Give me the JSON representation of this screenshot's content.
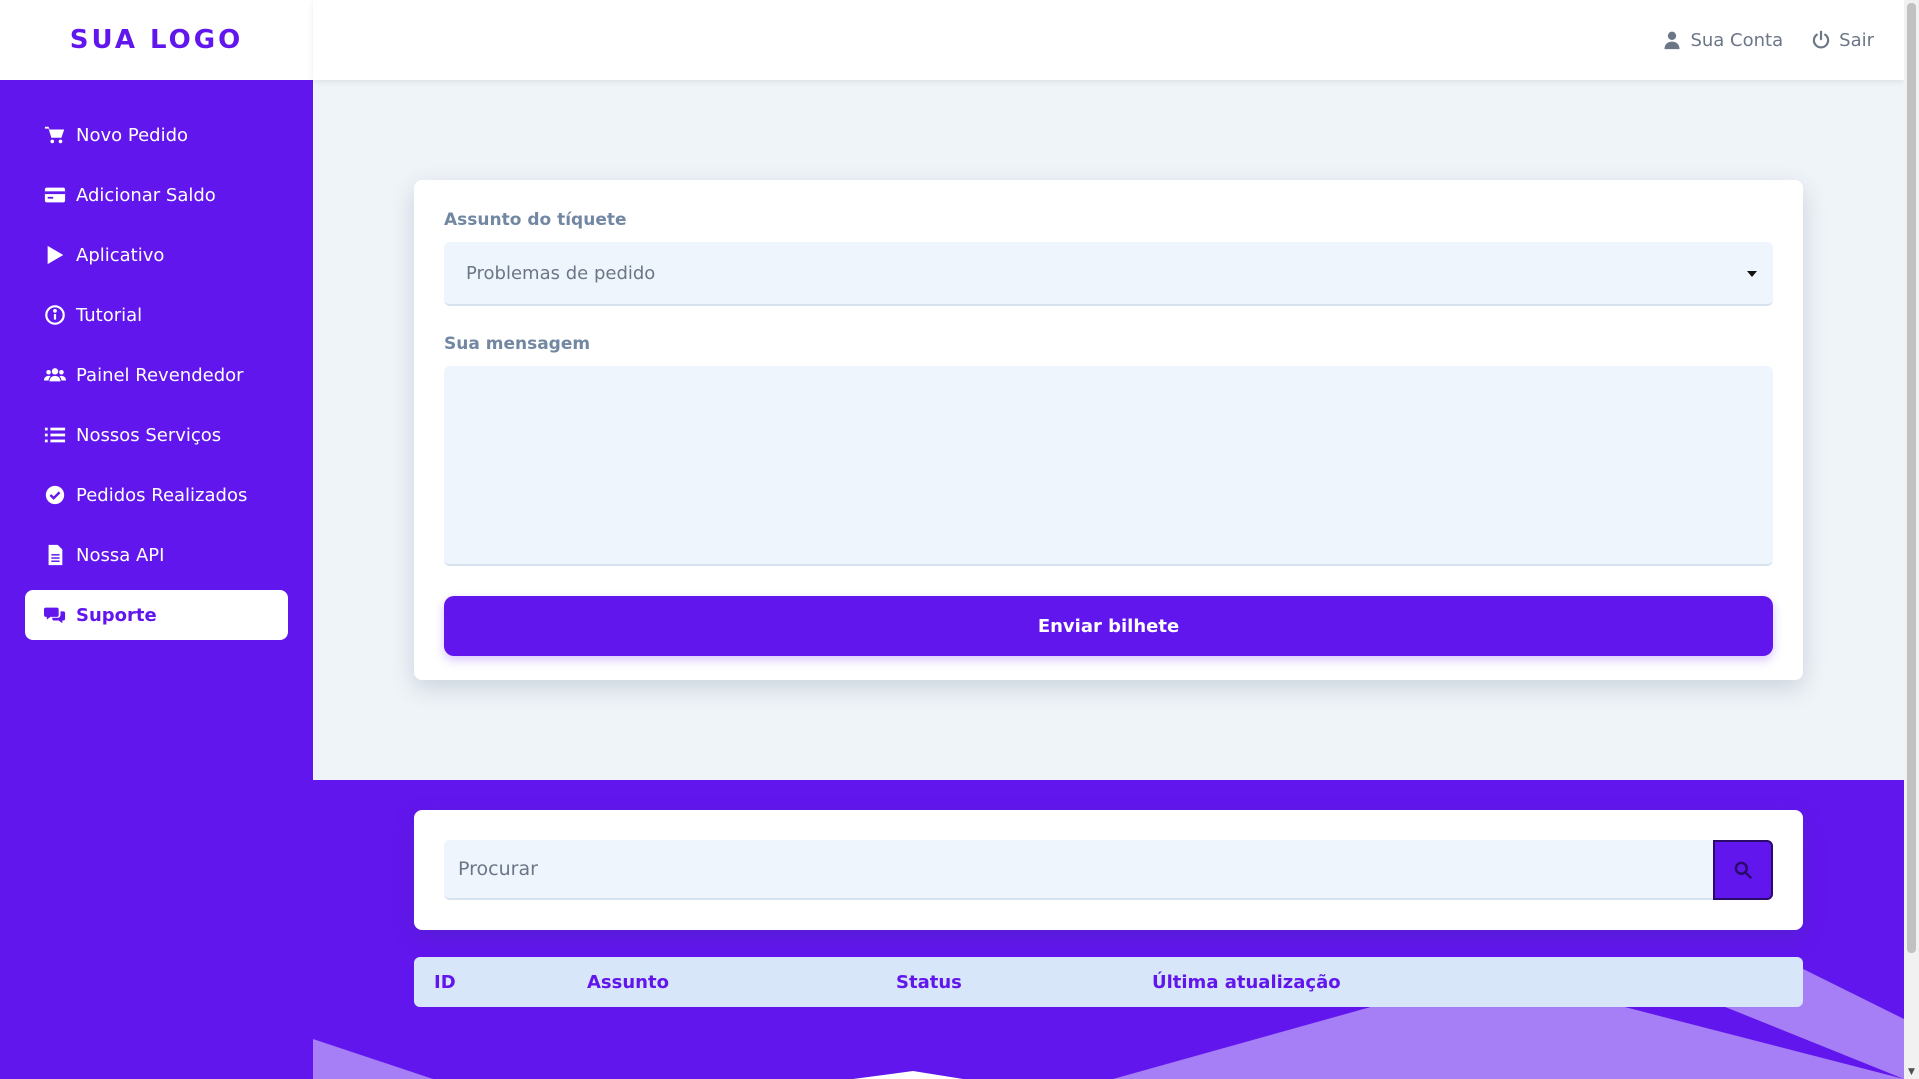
{
  "brand": {
    "logo": "SUA LOGO",
    "color": "#6216ee"
  },
  "sidebar": {
    "items": [
      {
        "label": "Novo Pedido",
        "icon": "cart-icon"
      },
      {
        "label": "Adicionar Saldo",
        "icon": "credit-card-icon"
      },
      {
        "label": "Aplicativo",
        "icon": "play-icon"
      },
      {
        "label": "Tutorial",
        "icon": "info-circle-icon"
      },
      {
        "label": "Painel Revendedor",
        "icon": "users-icon"
      },
      {
        "label": "Nossos Serviços",
        "icon": "list-icon"
      },
      {
        "label": "Pedidos Realizados",
        "icon": "check-circle-icon"
      },
      {
        "label": "Nossa API",
        "icon": "file-icon"
      },
      {
        "label": "Suporte",
        "icon": "comments-icon",
        "active": true
      }
    ]
  },
  "topbar": {
    "account_label": "Sua Conta",
    "logout_label": "Sair"
  },
  "ticket_form": {
    "subject_label": "Assunto do tíquete",
    "subject_value": "Problemas de pedido",
    "message_label": "Sua mensagem",
    "message_value": "",
    "submit_label": "Enviar bilhete"
  },
  "search": {
    "placeholder": "Procurar"
  },
  "table": {
    "columns": [
      "ID",
      "Assunto",
      "Status",
      "Última atualização"
    ]
  }
}
